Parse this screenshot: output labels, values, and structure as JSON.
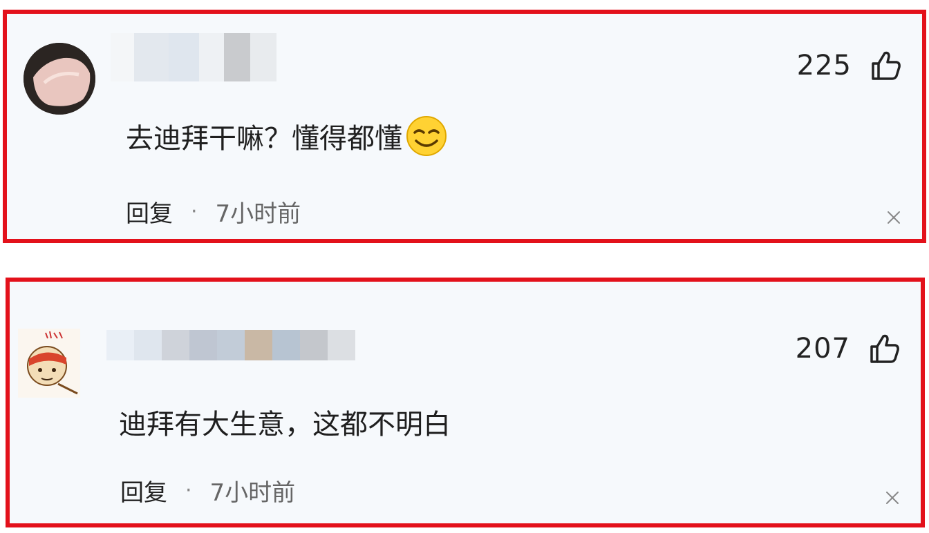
{
  "comments": [
    {
      "likes": "225",
      "text": "去迪拜干嘛？懂得都懂",
      "reply_label": "回复",
      "separator": "·",
      "time": "7小时前"
    },
    {
      "likes": "207",
      "text": "迪拜有大生意，这都不明白",
      "reply_label": "回复",
      "separator": "·",
      "time": "7小时前"
    }
  ],
  "colors": {
    "highlight_border": "#e3111b",
    "card_background": "#f6f9fc",
    "text_primary": "#1f1f1f",
    "text_secondary": "#666666"
  },
  "icons": [
    "avatar",
    "thumbs-up-icon",
    "smile-emoji-icon",
    "close-icon"
  ]
}
